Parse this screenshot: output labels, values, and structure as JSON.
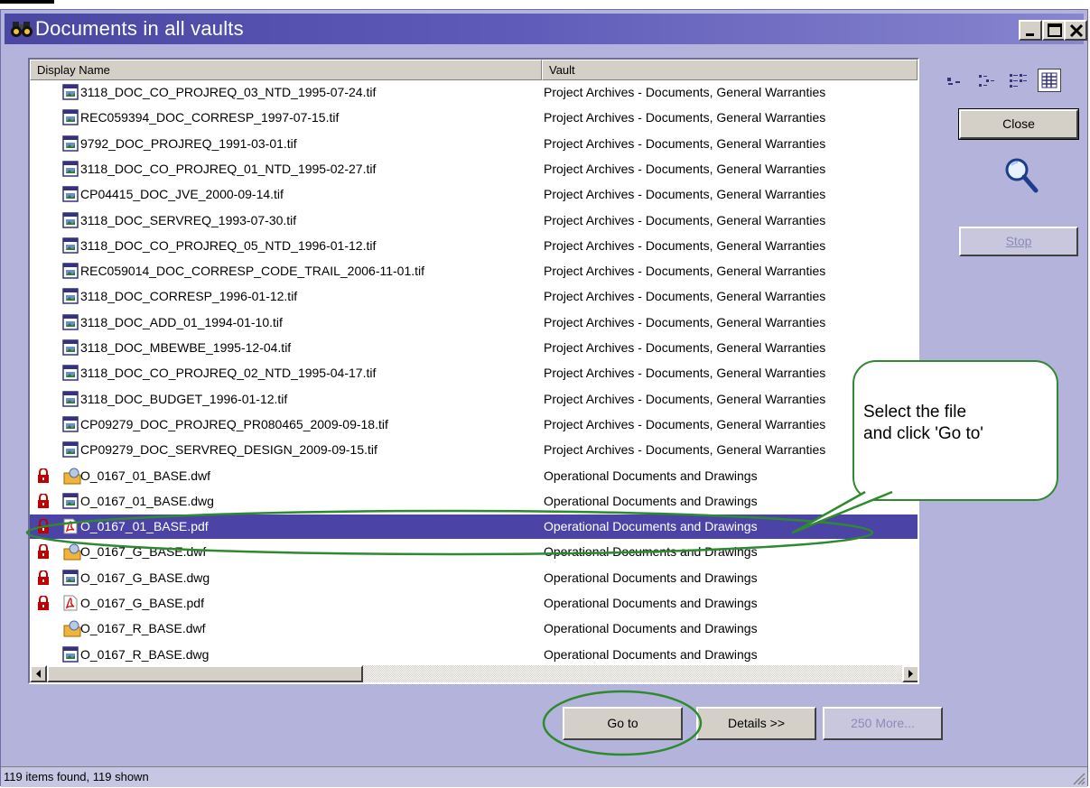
{
  "window": {
    "title": "Documents in all vaults",
    "title_icon": "binoculars-icon",
    "controls": [
      "minimize",
      "maximize",
      "close"
    ]
  },
  "list": {
    "columns": [
      "Display Name",
      "Vault"
    ],
    "rows": [
      {
        "name": "3118_DOC_CO_PROJREQ_03_NTD_1995-07-24.tif",
        "vault": "Project Archives - Documents, General Warranties",
        "icon": "image-file-icon",
        "locked": false,
        "selected": false
      },
      {
        "name": "REC059394_DOC_CORRESP_1997-07-15.tif",
        "vault": "Project Archives - Documents, General Warranties",
        "icon": "image-file-icon",
        "locked": false,
        "selected": false
      },
      {
        "name": "9792_DOC_PROJREQ_1991-03-01.tif",
        "vault": "Project Archives - Documents, General Warranties",
        "icon": "image-file-icon",
        "locked": false,
        "selected": false
      },
      {
        "name": "3118_DOC_CO_PROJREQ_01_NTD_1995-02-27.tif",
        "vault": "Project Archives - Documents, General Warranties",
        "icon": "image-file-icon",
        "locked": false,
        "selected": false
      },
      {
        "name": "CP04415_DOC_JVE_2000-09-14.tif",
        "vault": "Project Archives - Documents, General Warranties",
        "icon": "image-file-icon",
        "locked": false,
        "selected": false
      },
      {
        "name": "3118_DOC_SERVREQ_1993-07-30.tif",
        "vault": "Project Archives - Documents, General Warranties",
        "icon": "image-file-icon",
        "locked": false,
        "selected": false
      },
      {
        "name": "3118_DOC_CO_PROJREQ_05_NTD_1996-01-12.tif",
        "vault": "Project Archives - Documents, General Warranties",
        "icon": "image-file-icon",
        "locked": false,
        "selected": false
      },
      {
        "name": "REC059014_DOC_CORRESP_CODE_TRAIL_2006-11-01.tif",
        "vault": "Project Archives - Documents, General Warranties",
        "icon": "image-file-icon",
        "locked": false,
        "selected": false
      },
      {
        "name": "3118_DOC_CORRESP_1996-01-12.tif",
        "vault": "Project Archives - Documents, General Warranties",
        "icon": "image-file-icon",
        "locked": false,
        "selected": false
      },
      {
        "name": "3118_DOC_ADD_01_1994-01-10.tif",
        "vault": "Project Archives - Documents, General Warranties",
        "icon": "image-file-icon",
        "locked": false,
        "selected": false
      },
      {
        "name": "3118_DOC_MBEWBE_1995-12-04.tif",
        "vault": "Project Archives - Documents, General Warranties",
        "icon": "image-file-icon",
        "locked": false,
        "selected": false
      },
      {
        "name": "3118_DOC_CO_PROJREQ_02_NTD_1995-04-17.tif",
        "vault": "Project Archives - Documents, General Warranties",
        "icon": "image-file-icon",
        "locked": false,
        "selected": false
      },
      {
        "name": "3118_DOC_BUDGET_1996-01-12.tif",
        "vault": "Project Archives - Documents, General Warranties",
        "icon": "image-file-icon",
        "locked": false,
        "selected": false
      },
      {
        "name": "CP09279_DOC_PROJREQ_PR080465_2009-09-18.tif",
        "vault": "Project Archives - Documents, General Warranties",
        "icon": "image-file-icon",
        "locked": false,
        "selected": false
      },
      {
        "name": "CP09279_DOC_SERVREQ_DESIGN_2009-09-15.tif",
        "vault": "Project Archives - Documents, General Warranties",
        "icon": "image-file-icon",
        "locked": false,
        "selected": false
      },
      {
        "name": "O_0167_01_BASE.dwf",
        "vault": "Operational Documents and Drawings",
        "icon": "dwf-file-icon",
        "locked": true,
        "selected": false
      },
      {
        "name": "O_0167_01_BASE.dwg",
        "vault": "Operational Documents and Drawings",
        "icon": "image-file-icon",
        "locked": true,
        "selected": false
      },
      {
        "name": "O_0167_01_BASE.pdf",
        "vault": "Operational Documents and Drawings",
        "icon": "pdf-file-icon",
        "locked": true,
        "selected": true
      },
      {
        "name": "O_0167_G_BASE.dwf",
        "vault": "Operational Documents and Drawings",
        "icon": "dwf-file-icon",
        "locked": true,
        "selected": false
      },
      {
        "name": "O_0167_G_BASE.dwg",
        "vault": "Operational Documents and Drawings",
        "icon": "image-file-icon",
        "locked": true,
        "selected": false
      },
      {
        "name": "O_0167_G_BASE.pdf",
        "vault": "Operational Documents and Drawings",
        "icon": "pdf-file-icon",
        "locked": true,
        "selected": false
      },
      {
        "name": "O_0167_R_BASE.dwf",
        "vault": "Operational Documents and Drawings",
        "icon": "dwf-file-icon",
        "locked": false,
        "selected": false
      },
      {
        "name": "O_0167_R_BASE.dwg",
        "vault": "Operational Documents and Drawings",
        "icon": "image-file-icon",
        "locked": false,
        "selected": false
      }
    ]
  },
  "view_icons": [
    "large-icons-view-icon",
    "small-icons-view-icon",
    "list-view-icon",
    "details-view-icon"
  ],
  "buttons": {
    "close": "Close",
    "stop": "Stop",
    "goto": "Go to",
    "details": "Details >>",
    "more": "250 More..."
  },
  "search_icon": "magnifier-icon",
  "status": "119 items found, 119 shown",
  "callout": "Select the file\nand click 'Go to'",
  "colors": {
    "selection": "#4b44a6",
    "window_bg": "#b4b3dc",
    "annotation": "#2f8a2f",
    "lock": "#c00000"
  }
}
